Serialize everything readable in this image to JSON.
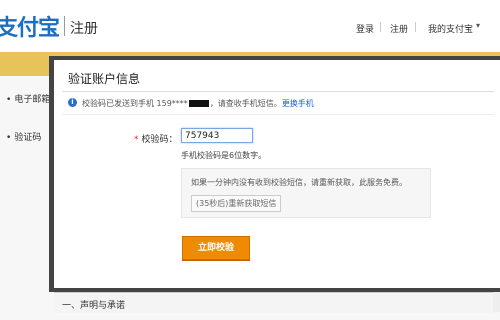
{
  "header": {
    "logo_text": "支付宝",
    "page_name": "注册",
    "nav": [
      "登录",
      "注册",
      "我的支付宝"
    ],
    "caret": "▾"
  },
  "background": {
    "items": [
      "电子邮箱",
      "验证码"
    ],
    "bottom_label": "一、声明与承诺"
  },
  "dialog": {
    "title": "验证账户信息",
    "info_prefix": "校验码已发送到手机 159****",
    "info_suffix": "，请查收手机短信。",
    "change_link": "更换手机",
    "field_label": "校验码：",
    "required_mark": "*",
    "code_value": "757943",
    "hint": "手机校验码是6位数字。",
    "notice_text": "如果一分钟内没有收到校验短信，请重新获取，此服务免费。",
    "resend_label": "(35秒后)重新获取短信",
    "submit_label": "立即校验"
  },
  "colors": {
    "accent": "#f08a00",
    "link": "#1b62c9",
    "brand": "#1a6fc4"
  }
}
